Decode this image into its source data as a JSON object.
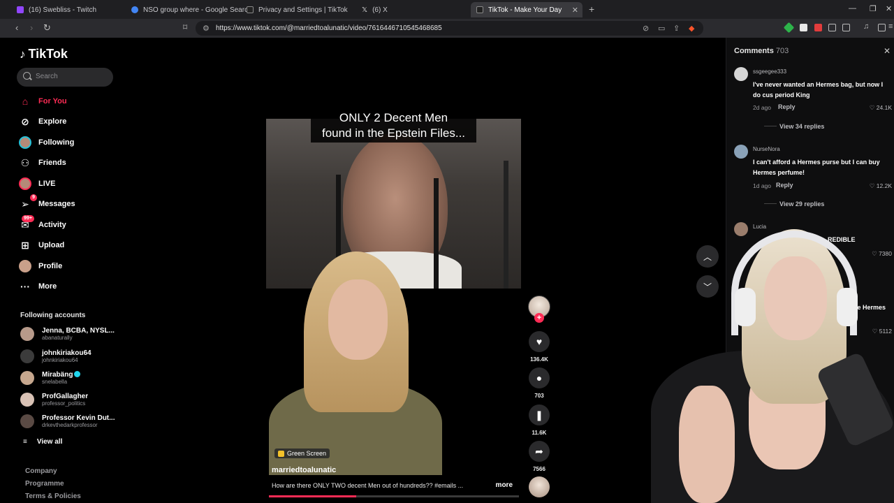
{
  "browser": {
    "tabs": [
      {
        "title": "(16) Swebliss - Twitch",
        "favicon_color": "#9146ff"
      },
      {
        "title": "NSO group where - Google Search",
        "favicon_color": "#4285f4"
      },
      {
        "title": "Privacy and Settings | TikTok",
        "favicon_color": "#111111"
      },
      {
        "title": "(6) X",
        "favicon_color": "#111111"
      },
      {
        "title": "TikTok - Make Your Day",
        "favicon_color": "#111111"
      }
    ],
    "url": "https://www.tiktok.com/@marriedtoalunatic/video/7616446710545468685"
  },
  "sidebar": {
    "brand": "TikTok",
    "search_placeholder": "Search",
    "nav": [
      {
        "label": "For You",
        "icon": "home-icon",
        "active": true
      },
      {
        "label": "Explore",
        "icon": "compass-icon"
      },
      {
        "label": "Following",
        "icon": "following-avatar"
      },
      {
        "label": "Friends",
        "icon": "friends-icon"
      },
      {
        "label": "LIVE",
        "icon": "live-avatar"
      },
      {
        "label": "Messages",
        "icon": "messages-icon",
        "badge": "9"
      },
      {
        "label": "Activity",
        "icon": "activity-icon",
        "badge": "99+"
      },
      {
        "label": "Upload",
        "icon": "upload-icon"
      },
      {
        "label": "Profile",
        "icon": "profile-avatar"
      },
      {
        "label": "More",
        "icon": "more-icon"
      }
    ],
    "following_title": "Following accounts",
    "accounts": [
      {
        "name": "Jenna, BCBA, NYSL...",
        "handle": "abanaturally",
        "color": "#b79a8a"
      },
      {
        "name": "johnkiriakou64",
        "handle": "johnkiriakou64",
        "color": "#3b3b3b"
      },
      {
        "name": "Mirabäng",
        "handle": "snelabella",
        "color": "#c6a78e",
        "verified": true
      },
      {
        "name": "ProfGallagher",
        "handle": "professor_politics",
        "color": "#d9c2b5"
      },
      {
        "name": "Professor Kevin Dut...",
        "handle": "drkevthedarkprofessor",
        "color": "#5a4a44"
      }
    ],
    "view_all": "View all",
    "footer": [
      "Company",
      "Programme",
      "Terms & Policies"
    ]
  },
  "video": {
    "overlay_line1": "ONLY 2 Decent Men",
    "overlay_line2": "found in the Epstein Files...",
    "effect_label": "Green Screen",
    "author": "marriedtoalunatic",
    "description": "How are there ONLY TWO decent Men out of hundreds?? #emails ...",
    "more": "more",
    "progress": 0.35,
    "likes": "136.4K",
    "comments": "703",
    "saves": "11.6K",
    "shares": "7566"
  },
  "comments_panel": {
    "title": "Comments",
    "count": "703",
    "items": [
      {
        "user": "ssgeegee333",
        "text": "I've never wanted an Hermes bag, but now I do cus period King",
        "age": "2d ago",
        "reply": "Reply",
        "likes": "24.1K",
        "view_replies": "View 34 replies"
      },
      {
        "user": "NurseNora",
        "text": "I can't afford a Hermes purse but I can buy Hermes perfume!",
        "age": "1d ago",
        "reply": "Reply",
        "likes": "12.2K",
        "view_replies": "View 29 replies"
      },
      {
        "user": "Lucia",
        "text_fragment": "REDIBLE",
        "likes": "7380"
      },
      {
        "text_fragment": "the Hermes",
        "likes": "5112"
      }
    ]
  }
}
